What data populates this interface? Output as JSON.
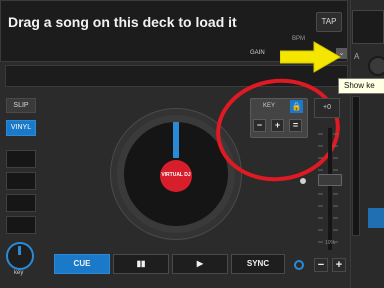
{
  "deck": {
    "title": "Drag a song on this deck to load it",
    "bpm_label": "BPM",
    "gain_label": "GAIN",
    "tap_label": "TAP",
    "gain_toggle_glyph": "⌄"
  },
  "left_controls": {
    "slip_label": "SLIP",
    "vinyl_label": "VINYL",
    "pads": [
      "",
      "",
      "",
      ""
    ],
    "key_knob_label": "key"
  },
  "jog": {
    "label_text": "VIRTUAL DJ"
  },
  "key_panel": {
    "label": "KEY",
    "lock_icon": "🔒",
    "minus": "−",
    "plus": "+",
    "equal": "="
  },
  "pitch": {
    "top_button": "+0",
    "scale_percent": "10%",
    "minus": "−",
    "plus": "+"
  },
  "transport": {
    "cue": "CUE",
    "pause": "▮▮",
    "play": "▶",
    "sync": "SYNC"
  },
  "right_deck": {
    "channel_letter": "A"
  },
  "tooltip": {
    "text": "Show ke"
  },
  "colors": {
    "accent_blue": "#1b79c9",
    "annotation_red": "#e01a22",
    "annotation_yellow": "#f5e600"
  }
}
